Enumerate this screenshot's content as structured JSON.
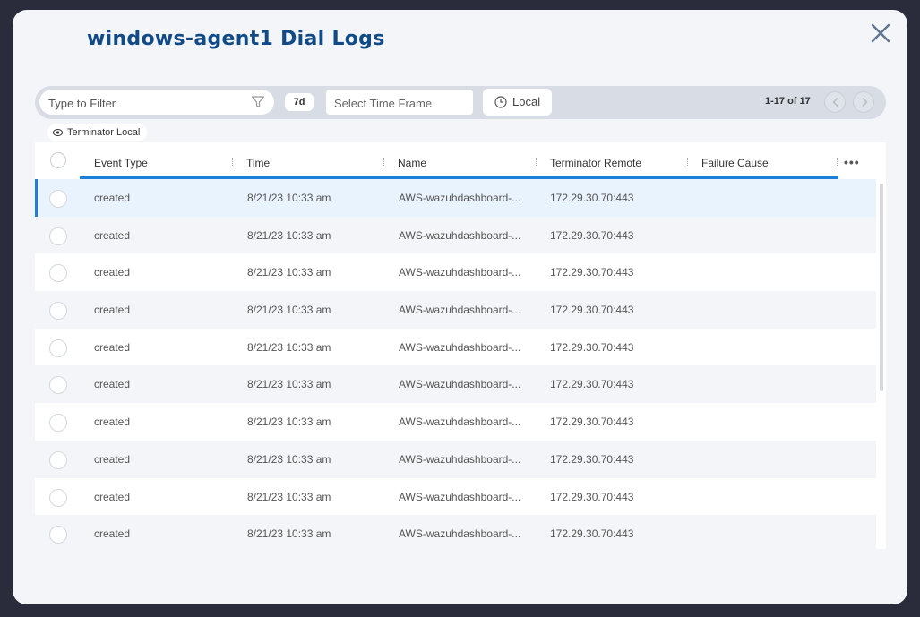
{
  "title": "windows-agent1 Dial Logs",
  "toolbar": {
    "filter_placeholder": "Type to Filter",
    "range_badge": "7d",
    "timeframe_placeholder": "Select Time Frame",
    "timezone_label": "Local",
    "page_count": "1-17 of 17"
  },
  "chip": {
    "label": "Terminator Local"
  },
  "table": {
    "columns": [
      "Event Type",
      "Time",
      "Name",
      "Terminator Remote",
      "Failure Cause"
    ],
    "rows": [
      {
        "event": "created",
        "time": "8/21/23 10:33 am",
        "name": "AWS-wazuhdashboard-...",
        "remote": "172.29.30.70:443",
        "failure": ""
      },
      {
        "event": "created",
        "time": "8/21/23 10:33 am",
        "name": "AWS-wazuhdashboard-...",
        "remote": "172.29.30.70:443",
        "failure": ""
      },
      {
        "event": "created",
        "time": "8/21/23 10:33 am",
        "name": "AWS-wazuhdashboard-...",
        "remote": "172.29.30.70:443",
        "failure": ""
      },
      {
        "event": "created",
        "time": "8/21/23 10:33 am",
        "name": "AWS-wazuhdashboard-...",
        "remote": "172.29.30.70:443",
        "failure": ""
      },
      {
        "event": "created",
        "time": "8/21/23 10:33 am",
        "name": "AWS-wazuhdashboard-...",
        "remote": "172.29.30.70:443",
        "failure": ""
      },
      {
        "event": "created",
        "time": "8/21/23 10:33 am",
        "name": "AWS-wazuhdashboard-...",
        "remote": "172.29.30.70:443",
        "failure": ""
      },
      {
        "event": "created",
        "time": "8/21/23 10:33 am",
        "name": "AWS-wazuhdashboard-...",
        "remote": "172.29.30.70:443",
        "failure": ""
      },
      {
        "event": "created",
        "time": "8/21/23 10:33 am",
        "name": "AWS-wazuhdashboard-...",
        "remote": "172.29.30.70:443",
        "failure": ""
      },
      {
        "event": "created",
        "time": "8/21/23 10:33 am",
        "name": "AWS-wazuhdashboard-...",
        "remote": "172.29.30.70:443",
        "failure": ""
      },
      {
        "event": "created",
        "time": "8/21/23 10:33 am",
        "name": "AWS-wazuhdashboard-...",
        "remote": "172.29.30.70:443",
        "failure": ""
      }
    ]
  },
  "colors": {
    "title": "#114a86",
    "accent": "#1d7fd8",
    "selected_row": "#e8f3fd"
  },
  "icons": [
    "close-icon",
    "filter-icon",
    "clock-icon",
    "chevron-left-icon",
    "chevron-right-icon",
    "eye-icon",
    "more-icon"
  ]
}
